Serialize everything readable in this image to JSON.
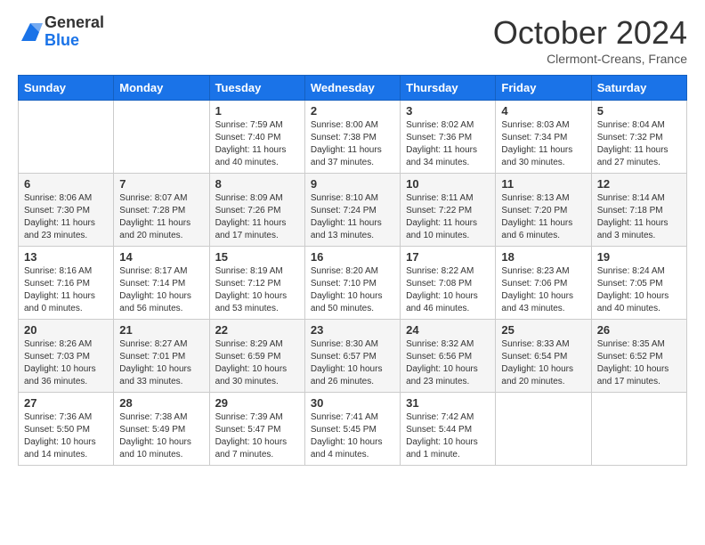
{
  "logo": {
    "general": "General",
    "blue": "Blue"
  },
  "title": "October 2024",
  "subtitle": "Clermont-Creans, France",
  "days_of_week": [
    "Sunday",
    "Monday",
    "Tuesday",
    "Wednesday",
    "Thursday",
    "Friday",
    "Saturday"
  ],
  "weeks": [
    [
      {
        "day": "",
        "sunrise": "",
        "sunset": "",
        "daylight": ""
      },
      {
        "day": "",
        "sunrise": "",
        "sunset": "",
        "daylight": ""
      },
      {
        "day": "1",
        "sunrise": "Sunrise: 7:59 AM",
        "sunset": "Sunset: 7:40 PM",
        "daylight": "Daylight: 11 hours and 40 minutes."
      },
      {
        "day": "2",
        "sunrise": "Sunrise: 8:00 AM",
        "sunset": "Sunset: 7:38 PM",
        "daylight": "Daylight: 11 hours and 37 minutes."
      },
      {
        "day": "3",
        "sunrise": "Sunrise: 8:02 AM",
        "sunset": "Sunset: 7:36 PM",
        "daylight": "Daylight: 11 hours and 34 minutes."
      },
      {
        "day": "4",
        "sunrise": "Sunrise: 8:03 AM",
        "sunset": "Sunset: 7:34 PM",
        "daylight": "Daylight: 11 hours and 30 minutes."
      },
      {
        "day": "5",
        "sunrise": "Sunrise: 8:04 AM",
        "sunset": "Sunset: 7:32 PM",
        "daylight": "Daylight: 11 hours and 27 minutes."
      }
    ],
    [
      {
        "day": "6",
        "sunrise": "Sunrise: 8:06 AM",
        "sunset": "Sunset: 7:30 PM",
        "daylight": "Daylight: 11 hours and 23 minutes."
      },
      {
        "day": "7",
        "sunrise": "Sunrise: 8:07 AM",
        "sunset": "Sunset: 7:28 PM",
        "daylight": "Daylight: 11 hours and 20 minutes."
      },
      {
        "day": "8",
        "sunrise": "Sunrise: 8:09 AM",
        "sunset": "Sunset: 7:26 PM",
        "daylight": "Daylight: 11 hours and 17 minutes."
      },
      {
        "day": "9",
        "sunrise": "Sunrise: 8:10 AM",
        "sunset": "Sunset: 7:24 PM",
        "daylight": "Daylight: 11 hours and 13 minutes."
      },
      {
        "day": "10",
        "sunrise": "Sunrise: 8:11 AM",
        "sunset": "Sunset: 7:22 PM",
        "daylight": "Daylight: 11 hours and 10 minutes."
      },
      {
        "day": "11",
        "sunrise": "Sunrise: 8:13 AM",
        "sunset": "Sunset: 7:20 PM",
        "daylight": "Daylight: 11 hours and 6 minutes."
      },
      {
        "day": "12",
        "sunrise": "Sunrise: 8:14 AM",
        "sunset": "Sunset: 7:18 PM",
        "daylight": "Daylight: 11 hours and 3 minutes."
      }
    ],
    [
      {
        "day": "13",
        "sunrise": "Sunrise: 8:16 AM",
        "sunset": "Sunset: 7:16 PM",
        "daylight": "Daylight: 11 hours and 0 minutes."
      },
      {
        "day": "14",
        "sunrise": "Sunrise: 8:17 AM",
        "sunset": "Sunset: 7:14 PM",
        "daylight": "Daylight: 10 hours and 56 minutes."
      },
      {
        "day": "15",
        "sunrise": "Sunrise: 8:19 AM",
        "sunset": "Sunset: 7:12 PM",
        "daylight": "Daylight: 10 hours and 53 minutes."
      },
      {
        "day": "16",
        "sunrise": "Sunrise: 8:20 AM",
        "sunset": "Sunset: 7:10 PM",
        "daylight": "Daylight: 10 hours and 50 minutes."
      },
      {
        "day": "17",
        "sunrise": "Sunrise: 8:22 AM",
        "sunset": "Sunset: 7:08 PM",
        "daylight": "Daylight: 10 hours and 46 minutes."
      },
      {
        "day": "18",
        "sunrise": "Sunrise: 8:23 AM",
        "sunset": "Sunset: 7:06 PM",
        "daylight": "Daylight: 10 hours and 43 minutes."
      },
      {
        "day": "19",
        "sunrise": "Sunrise: 8:24 AM",
        "sunset": "Sunset: 7:05 PM",
        "daylight": "Daylight: 10 hours and 40 minutes."
      }
    ],
    [
      {
        "day": "20",
        "sunrise": "Sunrise: 8:26 AM",
        "sunset": "Sunset: 7:03 PM",
        "daylight": "Daylight: 10 hours and 36 minutes."
      },
      {
        "day": "21",
        "sunrise": "Sunrise: 8:27 AM",
        "sunset": "Sunset: 7:01 PM",
        "daylight": "Daylight: 10 hours and 33 minutes."
      },
      {
        "day": "22",
        "sunrise": "Sunrise: 8:29 AM",
        "sunset": "Sunset: 6:59 PM",
        "daylight": "Daylight: 10 hours and 30 minutes."
      },
      {
        "day": "23",
        "sunrise": "Sunrise: 8:30 AM",
        "sunset": "Sunset: 6:57 PM",
        "daylight": "Daylight: 10 hours and 26 minutes."
      },
      {
        "day": "24",
        "sunrise": "Sunrise: 8:32 AM",
        "sunset": "Sunset: 6:56 PM",
        "daylight": "Daylight: 10 hours and 23 minutes."
      },
      {
        "day": "25",
        "sunrise": "Sunrise: 8:33 AM",
        "sunset": "Sunset: 6:54 PM",
        "daylight": "Daylight: 10 hours and 20 minutes."
      },
      {
        "day": "26",
        "sunrise": "Sunrise: 8:35 AM",
        "sunset": "Sunset: 6:52 PM",
        "daylight": "Daylight: 10 hours and 17 minutes."
      }
    ],
    [
      {
        "day": "27",
        "sunrise": "Sunrise: 7:36 AM",
        "sunset": "Sunset: 5:50 PM",
        "daylight": "Daylight: 10 hours and 14 minutes."
      },
      {
        "day": "28",
        "sunrise": "Sunrise: 7:38 AM",
        "sunset": "Sunset: 5:49 PM",
        "daylight": "Daylight: 10 hours and 10 minutes."
      },
      {
        "day": "29",
        "sunrise": "Sunrise: 7:39 AM",
        "sunset": "Sunset: 5:47 PM",
        "daylight": "Daylight: 10 hours and 7 minutes."
      },
      {
        "day": "30",
        "sunrise": "Sunrise: 7:41 AM",
        "sunset": "Sunset: 5:45 PM",
        "daylight": "Daylight: 10 hours and 4 minutes."
      },
      {
        "day": "31",
        "sunrise": "Sunrise: 7:42 AM",
        "sunset": "Sunset: 5:44 PM",
        "daylight": "Daylight: 10 hours and 1 minute."
      },
      {
        "day": "",
        "sunrise": "",
        "sunset": "",
        "daylight": ""
      },
      {
        "day": "",
        "sunrise": "",
        "sunset": "",
        "daylight": ""
      }
    ]
  ],
  "row_shading": [
    false,
    true,
    false,
    true,
    false
  ]
}
